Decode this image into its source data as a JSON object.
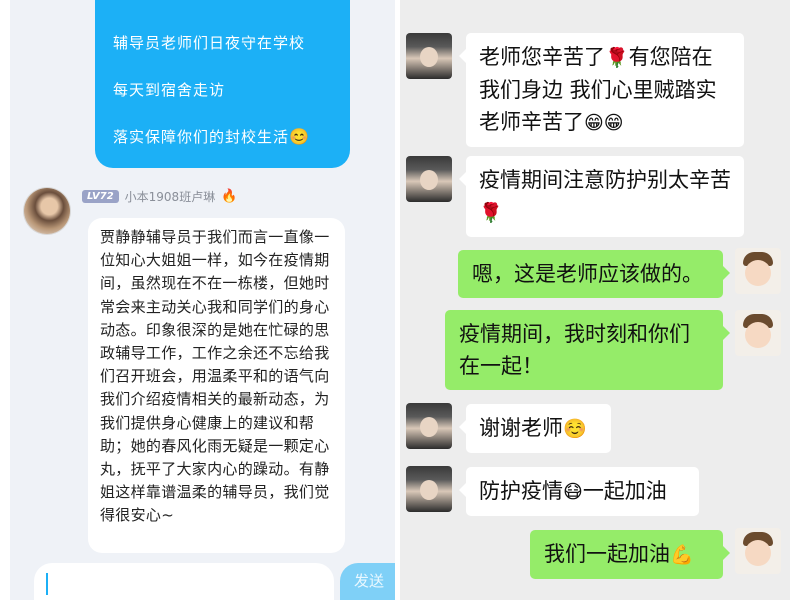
{
  "qq_chat": {
    "sent_message": {
      "lines": [
        "辅导员老师们日夜守在学校",
        "每天到宿舍走访",
        "落实保障你们的封校生活"
      ],
      "trailing_emoji": "😊"
    },
    "received": {
      "level_badge": "LV72",
      "sender_name": "小本1908班卢琳",
      "text": "贾静静辅导员于我们而言一直像一位知心大姐姐一样，如今在疫情期间，虽然现在不在一栋楼，但她时常会来主动关心我和同学们的身心动态。印象很深的是她在忙碌的思政辅导工作，工作之余还不忘给我们召开班会，用温柔平和的语气向我们介绍疫情相关的最新动态，为我们提供身心健康上的建议和帮助；她的春风化雨无疑是一颗定心丸，抚平了大家内心的躁动。有静姐这样靠谱温柔的辅导员，我们觉得很安心~"
    },
    "send_button": "发送",
    "colors": {
      "accent": "#1cb0f6",
      "background": "#eff2f7"
    }
  },
  "wechat_chat": {
    "messages": [
      {
        "from": "teacher",
        "text": "老师您辛苦了",
        "emoji": "🌹",
        "text2": "有您陪在我们身边 我们心里贼踏实老师辛苦了",
        "emoji2": "😁😁"
      },
      {
        "from": "teacher",
        "text": "疫情期间注意防护别太辛苦",
        "emoji": "🌹"
      },
      {
        "from": "me",
        "text": "嗯，这是老师应该做的。"
      },
      {
        "from": "me",
        "text": "疫情期间，我时刻和你们在一起！"
      },
      {
        "from": "teacher",
        "text": "谢谢老师",
        "emoji": "☺️"
      },
      {
        "from": "teacher",
        "text": "防护疫情",
        "emoji": "😷",
        "text2": "一起加油"
      },
      {
        "from": "me",
        "text": "我们一起加油",
        "emoji": "💪"
      }
    ],
    "colors": {
      "my_bubble": "#95ec69",
      "their_bubble": "#ffffff",
      "background": "#ededed"
    }
  }
}
